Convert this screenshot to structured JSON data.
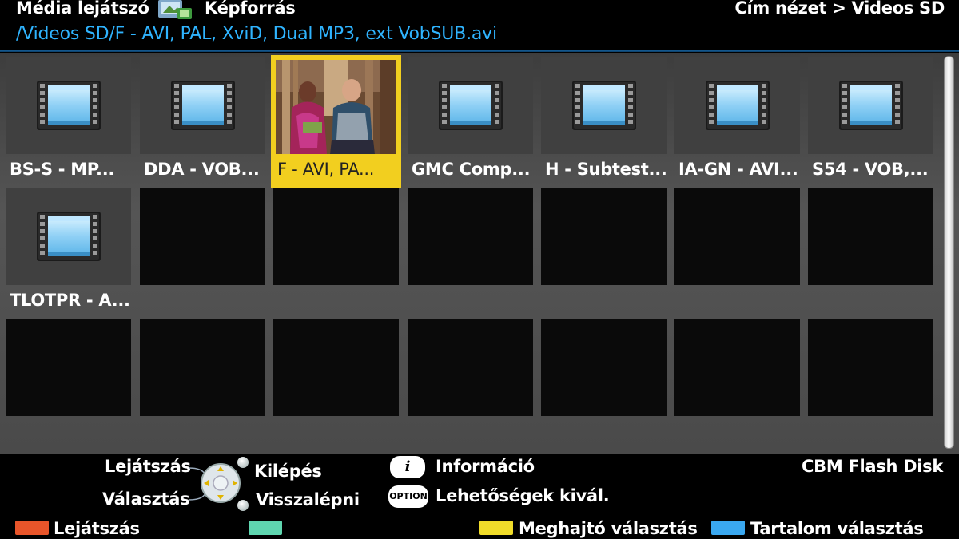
{
  "header": {
    "app_title": "Média lejátszó",
    "source_label": "Képforrás",
    "view_breadcrumb": "Cím nézet > Videos SD",
    "current_path": "/Videos SD/F - AVI, PAL, XviD, Dual MP3, ext VobSUB.avi"
  },
  "grid": {
    "items": [
      {
        "label": "BS-S - MP...",
        "icon": "film-icon",
        "selected": false
      },
      {
        "label": "DDA - VOB...",
        "icon": "film-icon",
        "selected": false
      },
      {
        "label": "F - AVI, PA...",
        "icon": "video-thumbnail",
        "selected": true
      },
      {
        "label": "GMC Comp...",
        "icon": "film-icon",
        "selected": false
      },
      {
        "label": "H - Subtest...",
        "icon": "film-icon",
        "selected": false
      },
      {
        "label": "IA-GN - AVI...",
        "icon": "film-icon",
        "selected": false
      },
      {
        "label": "S54 - VOB,...",
        "icon": "film-icon",
        "selected": false
      },
      {
        "label": "TLOTPR - A...",
        "icon": "film-icon",
        "selected": false
      }
    ],
    "columns": 7,
    "rows": 3
  },
  "footer": {
    "play_label": "Lejátszás",
    "select_label": "Választás",
    "exit_label": "Kilépés",
    "back_label": "Visszalépni",
    "info_button": "i",
    "info_label": "Információ",
    "option_button": "OPTION",
    "options_label": "Lehetőségek kivál.",
    "device_name": "CBM Flash Disk",
    "color_keys": [
      {
        "color": "#e8552a",
        "label": "Lejátszás"
      },
      {
        "color": "#5fd6b0",
        "label": ""
      },
      {
        "color": "#f0dc2a",
        "label": "Meghajtó választás"
      },
      {
        "color": "#3aa8f0",
        "label": "Tartalom választás"
      }
    ]
  },
  "colors": {
    "path_blue": "#2fb4ff",
    "selection_yellow": "#f2cf1f"
  }
}
